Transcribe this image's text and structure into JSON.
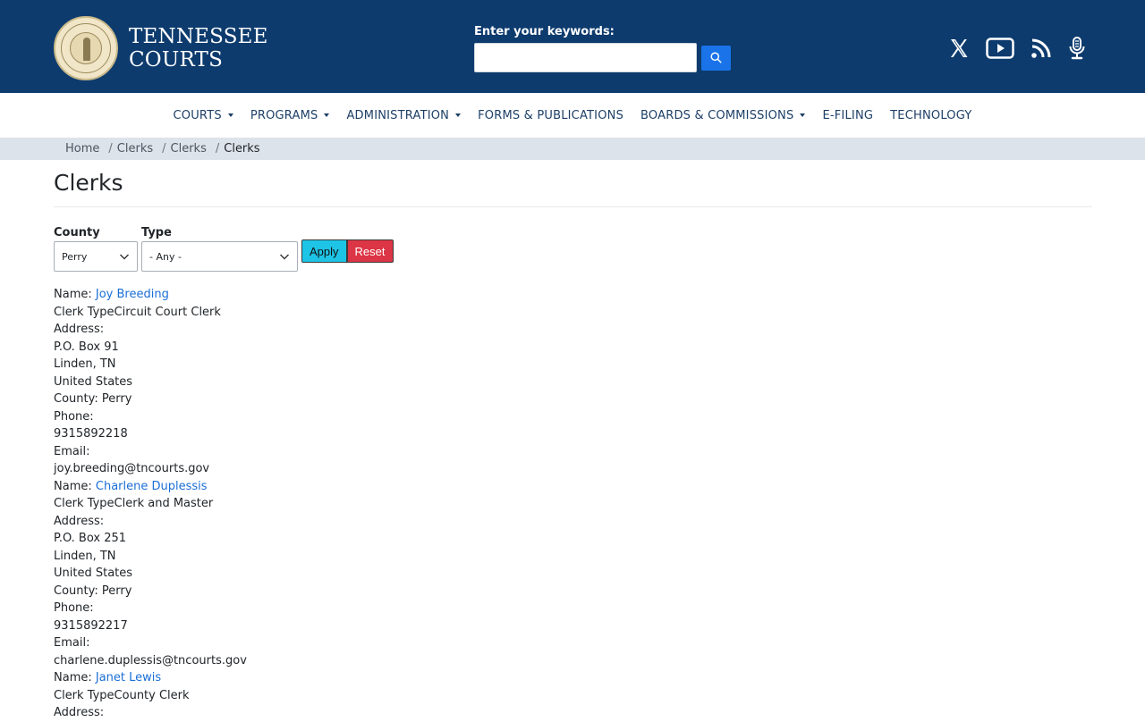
{
  "header": {
    "brand_line1": "TENNESSEE",
    "brand_line2": "COURTS",
    "search_label": "Enter your keywords:",
    "search_value": ""
  },
  "nav": {
    "items": [
      {
        "label": "COURTS",
        "dropdown": true
      },
      {
        "label": "PROGRAMS",
        "dropdown": true
      },
      {
        "label": "ADMINISTRATION",
        "dropdown": true
      },
      {
        "label": "FORMS & PUBLICATIONS",
        "dropdown": false
      },
      {
        "label": "BOARDS & COMMISSIONS",
        "dropdown": true
      },
      {
        "label": "E-FILING",
        "dropdown": false
      },
      {
        "label": "TECHNOLOGY",
        "dropdown": false
      }
    ]
  },
  "breadcrumb": {
    "items": [
      "Home",
      "Clerks",
      "Clerks"
    ],
    "current": "Clerks"
  },
  "page": {
    "title": "Clerks"
  },
  "filters": {
    "county_label": "County",
    "county_value": "Perry",
    "type_label": "Type",
    "type_value": "- Any -",
    "apply_label": "Apply",
    "reset_label": "Reset"
  },
  "clerks": [
    {
      "name_prefix": "Name: ",
      "name": "Joy Breeding",
      "clerk_type": "Clerk TypeCircuit Court Clerk",
      "address_label": "Address:",
      "street": "P.O. Box 91",
      "city": "Linden, TN",
      "country": "United States",
      "county": "County: Perry",
      "phone_label": "Phone:",
      "phone": "9315892218",
      "email_label": "Email:",
      "email": "joy.breeding@tncourts.gov"
    },
    {
      "name_prefix": "Name: ",
      "name": "Charlene Duplessis",
      "clerk_type": "Clerk TypeClerk and Master",
      "address_label": "Address:",
      "street": "P.O. Box 251",
      "city": "Linden, TN",
      "country": "United States",
      "county": "County: Perry",
      "phone_label": "Phone:",
      "phone": "9315892217",
      "email_label": "Email:",
      "email": "charlene.duplessis@tncourts.gov"
    },
    {
      "name_prefix": "Name: ",
      "name": "Janet Lewis",
      "clerk_type": "Clerk TypeCounty Clerk",
      "address_label": "Address:"
    }
  ],
  "icons": {
    "social": [
      "x-twitter-icon",
      "youtube-icon",
      "rss-icon",
      "podcast-microphone-icon"
    ],
    "search": "search-icon"
  },
  "colors": {
    "header_bg": "#0d3b6e",
    "nav_text": "#1d3f66",
    "breadcrumb_bg": "#dde3ea",
    "link": "#1a6fd6",
    "apply_bg": "#1ec4e6",
    "reset_bg": "#dc3545",
    "search_btn": "#1a73e8"
  }
}
